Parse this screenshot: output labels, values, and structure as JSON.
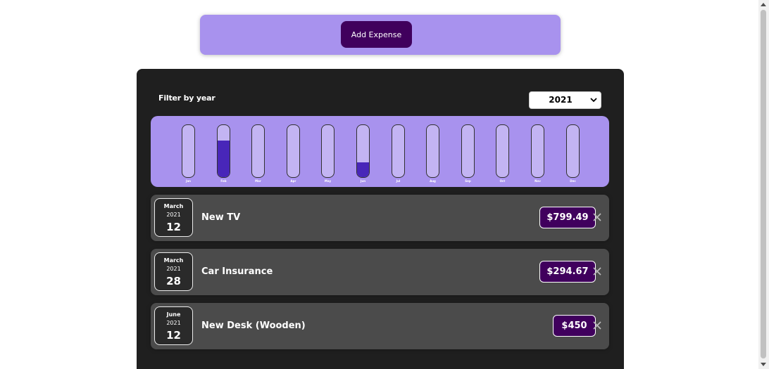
{
  "new_expense": {
    "add_button_label": "Add Expense"
  },
  "filter": {
    "label": "Filter by year",
    "selected_year": "2021"
  },
  "chart_data": {
    "type": "bar",
    "categories": [
      "Jan",
      "Feb",
      "Mar",
      "Apr",
      "May",
      "Jun",
      "Jul",
      "Aug",
      "Sep",
      "Oct",
      "Nov",
      "Dec"
    ],
    "values": [
      0,
      1094.16,
      0,
      0,
      0,
      450,
      0,
      0,
      0,
      0,
      0,
      0
    ],
    "max_value": 1094.16,
    "fill_fractions": [
      0,
      0.7,
      0,
      0,
      0,
      0.29,
      0,
      0,
      0,
      0,
      0,
      0
    ]
  },
  "expenses": [
    {
      "month": "March",
      "year": "2021",
      "day": "12",
      "title": "New TV",
      "amount": "$799.49"
    },
    {
      "month": "March",
      "year": "2021",
      "day": "28",
      "title": "Car Insurance",
      "amount": "$294.67"
    },
    {
      "month": "June",
      "year": "2021",
      "day": "12",
      "title": "New Desk (Wooden)",
      "amount": "$450"
    }
  ],
  "colors": {
    "accent": "#a892ee",
    "bar_fill": "#4826b9",
    "price_bg": "#40005d",
    "card_bg": "#1f1f1f",
    "item_bg": "#4b4b4b"
  },
  "icons": {
    "dropdown": "chevron-down-icon",
    "delete": "close-icon"
  }
}
